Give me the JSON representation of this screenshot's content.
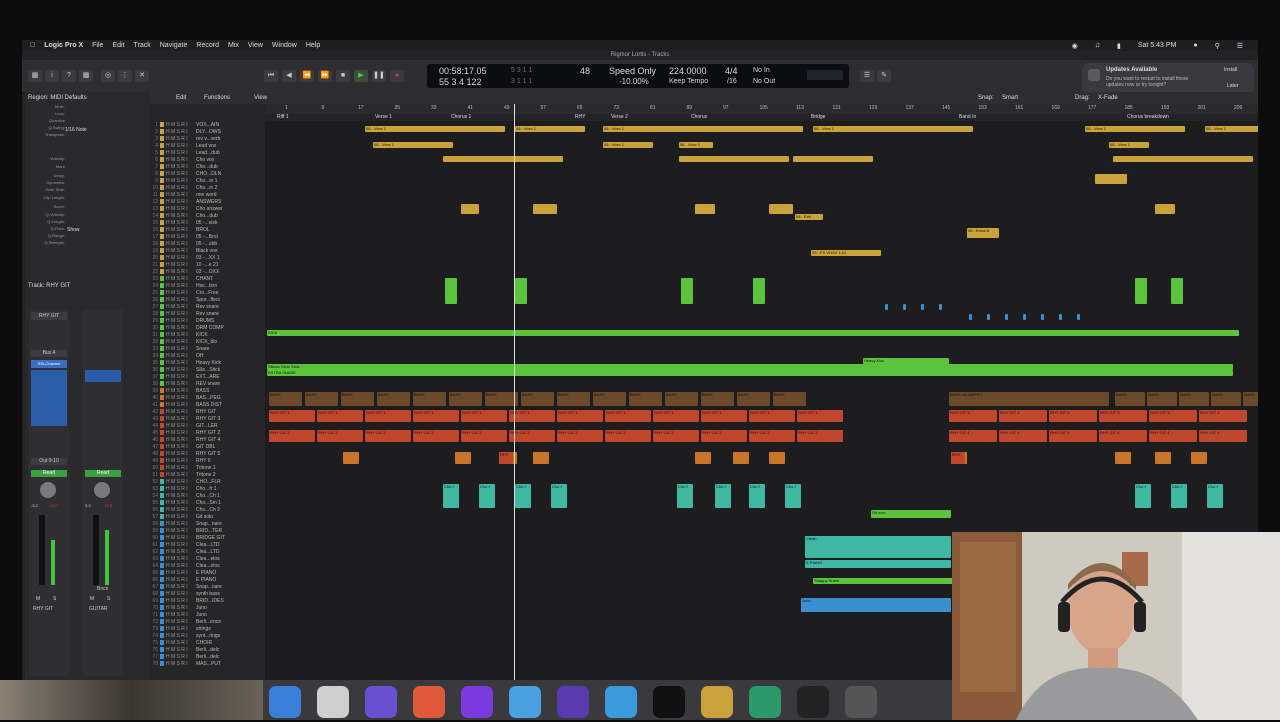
{
  "menubar": {
    "items": [
      "Logic Pro X",
      "File",
      "Edit",
      "Track",
      "Navigate",
      "Record",
      "Mix",
      "View",
      "Window",
      "Help"
    ],
    "clock": "Sat 5:43 PM"
  },
  "window": {
    "title": "Rigmor Lortis - Tracks"
  },
  "lcd": {
    "time": "00:58:17.05",
    "bars": "55 3 4 122",
    "small1": "5 3 1 1",
    "small2": "3 1 1 1",
    "division": "48",
    "mode": "Speed Only",
    "percent": "-10.00%",
    "tempo": "224.0000",
    "keep_tempo": "Keep Tempo",
    "sig": "4/4",
    "div": "/16",
    "in": "No In",
    "out": "No Out"
  },
  "notification": {
    "title": "Updates Available",
    "body": "Do you want to restart to install these updates now or try tonight?",
    "install": "Install",
    "later": "Later"
  },
  "inspector": {
    "region_label": "Region: MIDI Defaults",
    "fields": [
      "Mute:",
      "Loop:",
      "Quantize",
      "Q-Swing:",
      "Transpose:",
      "Velocity:",
      "More",
      "Delay:",
      "Dynamics:",
      "Gate Time:",
      "Clip Length:",
      "Score:",
      "Q-Velocity:",
      "Q-Length:",
      "Q-Flam:",
      "Q-Range:",
      "Q-Strength:"
    ],
    "quantize_value": "1/16 Note",
    "score_value": "Show",
    "track_label": "Track: RHY GIT",
    "strip1_name": "RHY GIT",
    "strip2_name": "GUITAR",
    "bus": "Bus 4",
    "eq1": "SSLChannel",
    "read": "Read",
    "out": "Out 9-10",
    "vol1": "-5.2",
    "vol2": "-18.7",
    "vol3": "5.3",
    "vol4": "-13.8",
    "bnce": "Bnce",
    "m": "M",
    "s": "S"
  },
  "arrange_toolbar": {
    "edit": "Edit",
    "functions": "Functions",
    "view": "View",
    "snap_label": "Snap:",
    "snap_value": "Smart",
    "drag_label": "Drag:",
    "drag_value": "X-Fade"
  },
  "ruler": [
    "1",
    "9",
    "17",
    "25",
    "33",
    "41",
    "49",
    "57",
    "65",
    "73",
    "81",
    "89",
    "97",
    "105",
    "113",
    "121",
    "129",
    "137",
    "145",
    "153",
    "161",
    "169",
    "177",
    "185",
    "193",
    "201",
    "209"
  ],
  "markers": [
    "Riff 1",
    "Verse 1",
    "Chorus 1",
    "RHY",
    "Verse 2",
    "Chorus",
    "Bridge",
    "Band In",
    "Chorus breakdown"
  ],
  "tracks": [
    "VOX...AIN",
    "DLY...OWS",
    "rev v...verb",
    "Lead vox",
    "Lead...dub",
    "Cho vox",
    "Cho...dub",
    "CHO...DLN",
    "Cho...in 1",
    "Cho...in 2",
    "one word",
    "ANSWERS",
    "Cho answer",
    "Cho...dub",
    "05 -...visk",
    "BROL",
    "05 -...Brol",
    "05 -...ubb",
    "Black vox",
    "03 -...XX 1",
    "10 -...e 21",
    "03 -...OXX",
    "CHANT",
    "Hoc...tion",
    "Cro...Free",
    "Spor...ffect",
    "Rev snare",
    "Rev snare",
    "DRUMS",
    "DRM COMP",
    "KICK",
    "KICK_blo",
    "Snare",
    "OH",
    "Heavy Kick",
    "Silic...Stick",
    "EXT...ARE",
    "REV snare",
    "BASS",
    "BAS...PEG",
    "BASS DIST",
    "RHY GIT",
    "RHY GIT 3",
    "GIT...LER",
    "RHY GIT 2",
    "RHY GIT 4",
    "GIT DBL",
    "RHY GIT 5",
    "RHY 6",
    "Tritone 1",
    "Tritone 2",
    "CHO...FLR",
    "Cho...fr 1",
    "Cho...Ch 1",
    "Cho...Sm 1",
    "Cho...Ch 2",
    "Git solo",
    "Snap...nare",
    "BRID...TER",
    "BRIDGE GIT",
    "Clea...LTD",
    "Clea...LTD",
    "Clea...elos",
    "Clea...elos",
    "E PIANO",
    "E PIANO",
    "Snap...nare",
    "synth bass",
    "BRID...IDES",
    "Juno",
    "Juno",
    "Berli...ence",
    "strings",
    "synt...rings",
    "CHOIR",
    "Berli...delc",
    "Berli...delc",
    "MAS...PUT"
  ],
  "region_labels": {
    "voxx": "06 - Voxx 1",
    "kick": "KICK",
    "silicon": "Silicon Slide Stick",
    "extra": "EXTRA SNARE",
    "heavy": "Heavy Kick",
    "bass": "BASS",
    "rhy1": "RHY GIT 1",
    "rhy2": "RHY GIT 2",
    "rhy3": "RHY GIT 3",
    "rhy4": "RHY GIT 4",
    "chof": "Cho f",
    "clean": "Clean",
    "juno": "Juno",
    "bassamp": "BASS UA AMPEG",
    "fx": "03 - FX VOXX 1,01",
    "gitsolo": "Git solo",
    "epiano": "E PIANO",
    "snap": "Snappy Snare",
    "rhy": "RHY",
    "extra2": "05 - Extra B",
    "exit": "08 - Exit"
  },
  "colors": {
    "accent": "#3b7de0",
    "gold": "#c9a23a",
    "green": "#5cc43a",
    "red": "#c0472b",
    "orange": "#c9762b",
    "teal": "#3fb8a3",
    "blue": "#3a8fd0"
  }
}
